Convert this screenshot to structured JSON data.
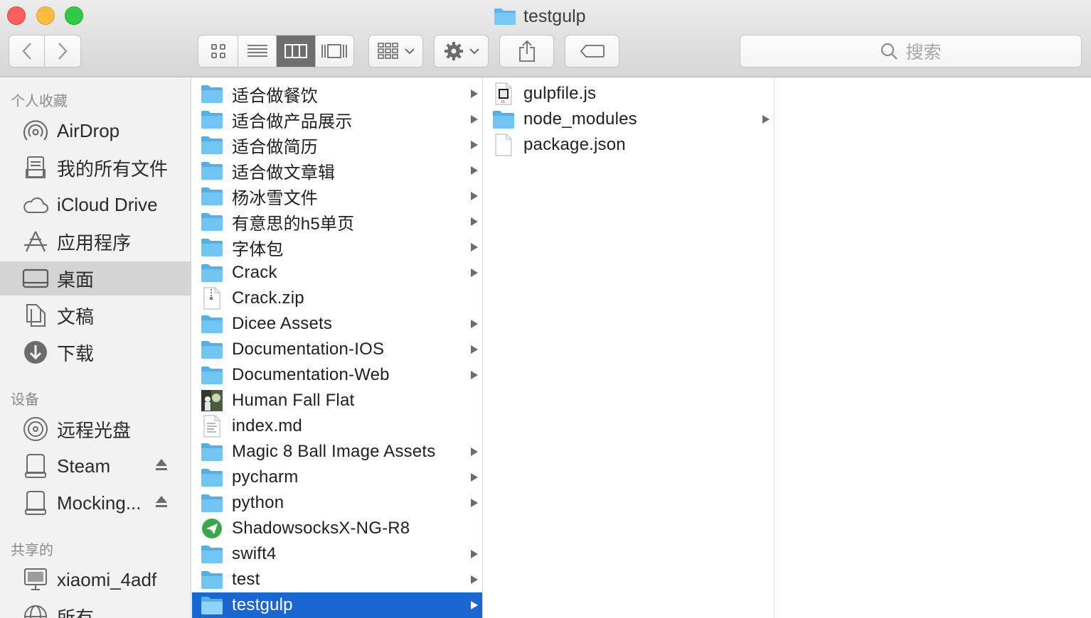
{
  "window": {
    "title": "testgulp"
  },
  "toolbar": {
    "back_label": "back",
    "forward_label": "forward",
    "view_modes": [
      "icon-view",
      "list-view",
      "column-view",
      "cover-flow-view"
    ],
    "active_view": "column-view",
    "search_placeholder": "搜索"
  },
  "sidebar": {
    "sections": {
      "favorites": "个人收藏",
      "devices": "设备",
      "shared": "共享的"
    },
    "favorites": [
      {
        "label": "AirDrop",
        "icon": "airdrop-icon"
      },
      {
        "label": "我的所有文件",
        "icon": "all-files-icon"
      },
      {
        "label": "iCloud Drive",
        "icon": "cloud-icon"
      },
      {
        "label": "应用程序",
        "icon": "applications-icon"
      },
      {
        "label": "桌面",
        "icon": "desktop-icon",
        "selected": true
      },
      {
        "label": "文稿",
        "icon": "documents-icon"
      },
      {
        "label": "下载",
        "icon": "download-icon"
      }
    ],
    "devices": [
      {
        "label": "远程光盘",
        "icon": "disc-icon"
      },
      {
        "label": "Steam",
        "icon": "drive-icon",
        "eject": true
      },
      {
        "label": "Mocking...",
        "icon": "drive-icon",
        "eject": true
      }
    ],
    "shared": [
      {
        "label": "xiaomi_4adf",
        "icon": "computer-icon"
      },
      {
        "label": "所有",
        "icon": "network-icon"
      }
    ]
  },
  "columns": {
    "desktop_items": [
      {
        "label": "适合做餐饮",
        "kind": "folder"
      },
      {
        "label": "适合做产品展示",
        "kind": "folder"
      },
      {
        "label": "适合做简历",
        "kind": "folder"
      },
      {
        "label": "适合做文章辑",
        "kind": "folder"
      },
      {
        "label": "杨冰雪文件",
        "kind": "folder"
      },
      {
        "label": "有意思的h5单页",
        "kind": "folder"
      },
      {
        "label": "字体包",
        "kind": "folder"
      },
      {
        "label": "Crack",
        "kind": "folder"
      },
      {
        "label": "Crack.zip",
        "kind": "zip"
      },
      {
        "label": "Dicee Assets",
        "kind": "folder"
      },
      {
        "label": "Documentation-IOS",
        "kind": "folder"
      },
      {
        "label": "Documentation-Web",
        "kind": "folder"
      },
      {
        "label": "Human Fall Flat",
        "kind": "app-image"
      },
      {
        "label": "index.md",
        "kind": "text"
      },
      {
        "label": "Magic 8 Ball Image Assets",
        "kind": "folder"
      },
      {
        "label": "pycharm",
        "kind": "folder"
      },
      {
        "label": "python",
        "kind": "folder"
      },
      {
        "label": "ShadowsocksX-NG-R8",
        "kind": "app"
      },
      {
        "label": "swift4",
        "kind": "folder"
      },
      {
        "label": "test",
        "kind": "folder"
      },
      {
        "label": "testgulp",
        "kind": "folder",
        "selected": true
      }
    ],
    "testgulp_items": [
      {
        "label": "gulpfile.js",
        "kind": "script"
      },
      {
        "label": "node_modules",
        "kind": "folder"
      },
      {
        "label": "package.json",
        "kind": "file"
      }
    ]
  },
  "colors": {
    "selection_blue": "#1a67d2",
    "folder_blue": "#6cc0f2",
    "sidebar_bg": "#f2f2f2",
    "sidebar_selected": "#d4d4d4"
  }
}
